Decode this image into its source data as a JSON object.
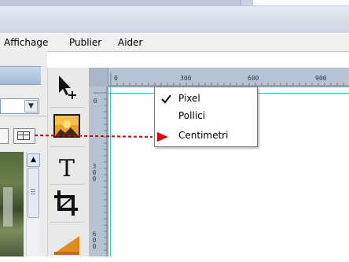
{
  "menubar": {
    "items": [
      {
        "label": "Affichage"
      },
      {
        "label": "Publier"
      },
      {
        "label": "Aider"
      }
    ]
  },
  "ruler": {
    "top_labels": [
      "0",
      "300",
      "600",
      "900"
    ],
    "left_labels": [
      "0",
      "300",
      "600"
    ]
  },
  "context_menu": {
    "items": [
      {
        "label": "Pixel",
        "checked": true
      },
      {
        "label": "Pollici",
        "checked": false
      },
      {
        "label": "Centimetri",
        "checked": false
      }
    ]
  },
  "icons": {
    "tools": [
      "select-arrow-icon",
      "image-icon",
      "text-icon",
      "crop-icon",
      "shape-icon"
    ],
    "left_panel": [
      "chevron-down-icon",
      "grid-icon",
      "scroll-up-icon"
    ],
    "menu": [
      "checkmark-icon",
      "red-arrow-pointer-icon"
    ]
  },
  "colors": {
    "guide": "#37c9c9",
    "pointer": "#e00000",
    "ruler": "#b8c3d1",
    "header": "#a7bad6"
  }
}
